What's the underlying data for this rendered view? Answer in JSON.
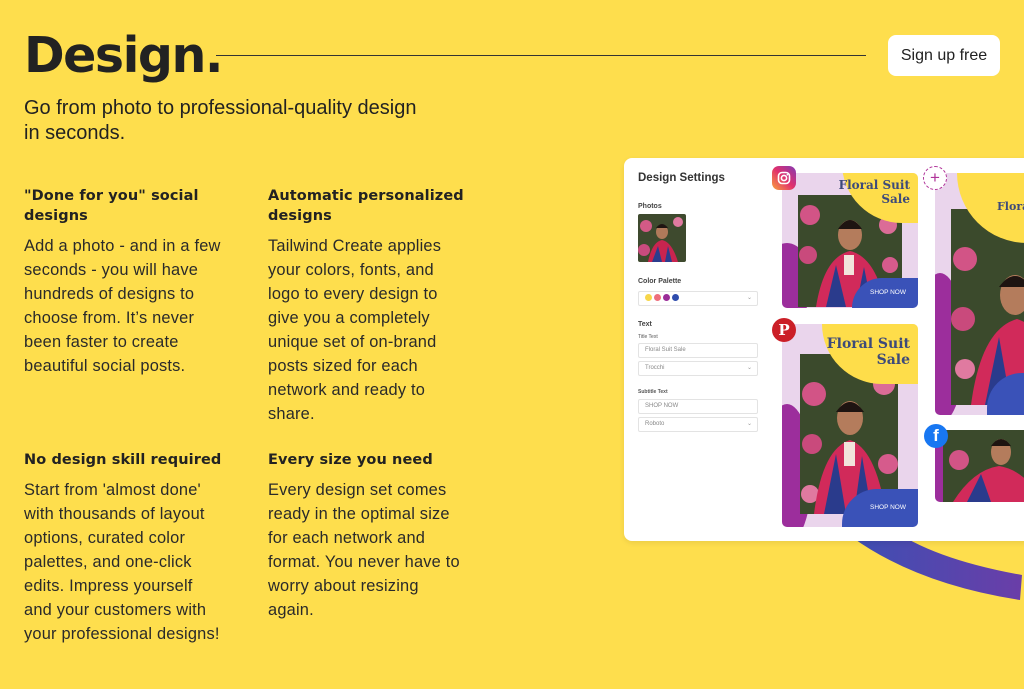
{
  "hero": {
    "title": "Design.",
    "subtitle": "Go from photo to professional-quality design in seconds.",
    "signup_label": "Sign up free"
  },
  "features": [
    {
      "title": "\"Done for you\" social designs",
      "body": "Add a photo - and in a few seconds - you will have hundreds of designs to choose from. It’s never been faster to create beautiful social posts."
    },
    {
      "title": "Automatic personalized designs",
      "body": "Tailwind Create applies your colors, fonts, and logo to every design to give you a completely unique set of on-brand posts sized for each network and ready to share."
    },
    {
      "title": "No design skill required",
      "body": "Start from 'almost done' with thousands of layout options, curated color palettes, and one-click edits. Impress yourself and your customers with your professional designs!"
    },
    {
      "title": "Every size you need",
      "body": "Every design set comes ready in the optimal size for each network and format. You never have to worry about resizing again."
    }
  ],
  "mockup": {
    "panel_title": "Design Settings",
    "photos_label": "Photos",
    "color_palette_label": "Color Palette",
    "palette_colors": [
      "#f7d64a",
      "#ee6f7d",
      "#9b2d98",
      "#2f4cad"
    ],
    "text_label": "Text",
    "title_text_label": "Title Text",
    "title_text_value": "Floral Suit Sale",
    "title_font": "Trocchi",
    "subtitle_text_label": "Subtitle Text",
    "subtitle_text_value": "SHOP NOW",
    "subtitle_font": "Roboto",
    "card_headline_line1": "Floral Suit",
    "card_headline_line2": "Sale",
    "card_cta": "SHOP NOW",
    "networks": [
      "instagram",
      "pinterest",
      "add",
      "facebook"
    ],
    "pinterest_glyph": "P",
    "facebook_glyph": "f",
    "add_glyph": "+"
  },
  "colors": {
    "background": "#fede4d",
    "text": "#222222",
    "card_yellow": "#fedd4a",
    "card_blue": "#3a52b8",
    "card_purple": "#9c2e9c",
    "card_lilac": "#ead5ec"
  }
}
